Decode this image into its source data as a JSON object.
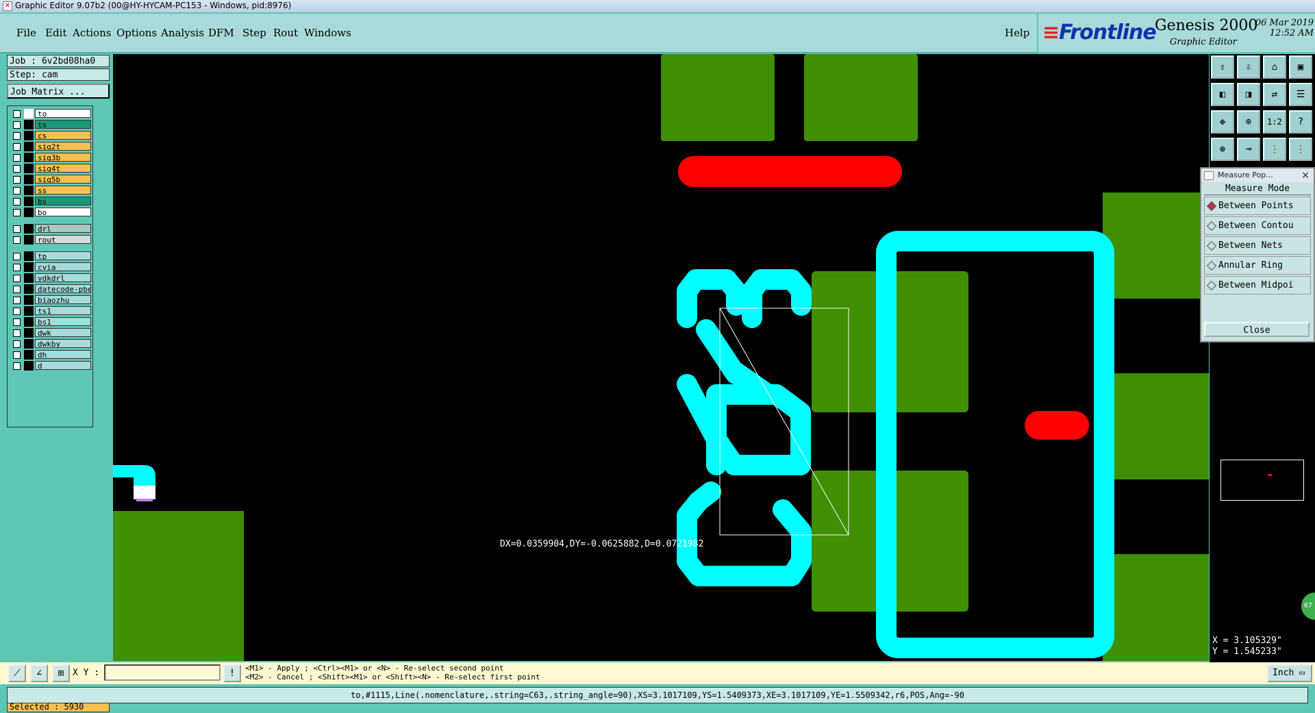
{
  "window": {
    "title": "Graphic Editor 9.07b2 (00@HY-HYCAM-PC153 - Windows, pid:8976)"
  },
  "menu": [
    "File",
    "Edit",
    "Actions",
    "Options",
    "Analysis",
    "DFM",
    "Step",
    "Rout",
    "Windows"
  ],
  "help": "Help",
  "brand": {
    "logo": "Frontline",
    "product": "Genesis 2000",
    "subtitle": "Graphic Editor",
    "date": "06 Mar 2019",
    "time": "12:52 AM"
  },
  "job": {
    "job_label": "Job : 6v2bd08ha0",
    "step_label": "Step: cam",
    "matrix_button": "Job Matrix ..."
  },
  "layers_group1": [
    {
      "name": "to",
      "color": "#ffffff"
    },
    {
      "name": "ts",
      "color": "#1a9a7a"
    },
    {
      "name": "cs",
      "color": "#f6c050"
    },
    {
      "name": "sig2t",
      "color": "#f6c050"
    },
    {
      "name": "sig3b",
      "color": "#f6c050"
    },
    {
      "name": "sig4t",
      "color": "#f6c050"
    },
    {
      "name": "sig5b",
      "color": "#f6c050"
    },
    {
      "name": "ss",
      "color": "#f6c050"
    },
    {
      "name": "bs",
      "color": "#1a9a7a"
    },
    {
      "name": "bo",
      "color": "#ffffff"
    }
  ],
  "layers_group2": [
    {
      "name": "drl",
      "color": "#a8c8c8"
    },
    {
      "name": "rout",
      "color": "#d8d8d8"
    }
  ],
  "layers_group3": [
    {
      "name": "tp",
      "color": "#a8dada"
    },
    {
      "name": "cvia",
      "color": "#a8dada"
    },
    {
      "name": "ydkdrl",
      "color": "#a8dada"
    },
    {
      "name": "datecode-pbe",
      "color": "#a8dada"
    },
    {
      "name": "biaozhu",
      "color": "#a8dada"
    },
    {
      "name": "ts1",
      "color": "#a8dada"
    },
    {
      "name": "bs1",
      "color": "#a8dada"
    },
    {
      "name": "dwk",
      "color": "#a8dada"
    },
    {
      "name": "dwkby",
      "color": "#a8dada"
    },
    {
      "name": "dh",
      "color": "#a8dada"
    },
    {
      "name": "d",
      "color": "#a8dada"
    }
  ],
  "selected": "Selected : 5930",
  "canvas": {
    "measure_readout": "DX=0.0359904,DY=-0.0625882,D=0.0721982",
    "silkscreen_text": "C63"
  },
  "measure_popup": {
    "header": "Measure Pop...",
    "title": "Measure Mode",
    "options": [
      "Between Points",
      "Between Contou",
      "Between Nets",
      "Annular Ring",
      "Between Midpoi"
    ],
    "selected_option": 0,
    "close": "Close"
  },
  "coords": {
    "x": "X = 3.105329\"",
    "y": "Y = 1.545233\""
  },
  "status": {
    "xy_label": "X Y :",
    "xy_value": "",
    "hint_line1": "<M1> - Apply  ; <Ctrl><M1> or <N> - Re-select second point",
    "hint_line2": "<M2> - Cancel ; <Shift><M1> or <Shift><N> - Re-select first point",
    "unit": "Inch",
    "feature_info": "to,#1115,Line(.nomenclature,.string=C63,.string_angle=90),XS=3.1017109,YS=1.5409373,XE=3.1017109,YE=1.5509342,r6,POS,Ang=-90"
  },
  "colors": {
    "pad_green": "#3f8f00",
    "silk_cyan": "#00ffff",
    "mask_red": "#ff0000",
    "panel_teal": "#5fc7b6"
  }
}
